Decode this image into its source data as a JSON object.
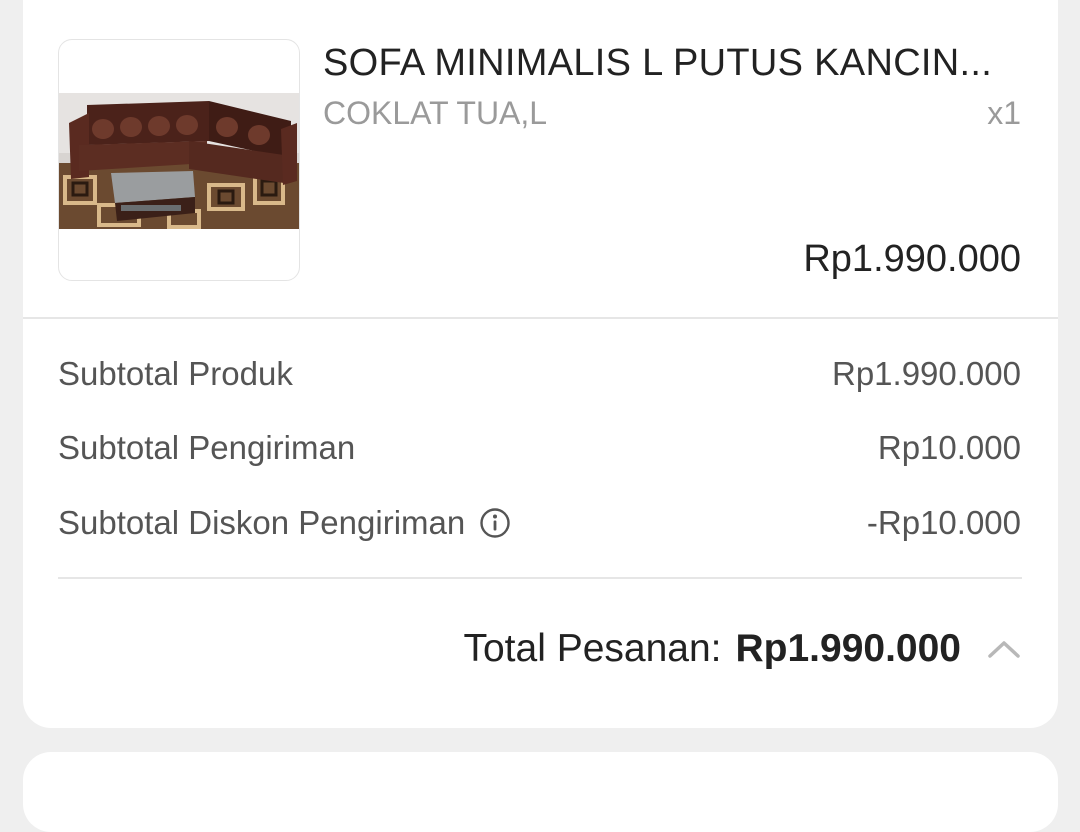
{
  "order_item": {
    "name": "SOFA MINIMALIS L PUTUS KANCIN...",
    "variant": "COKLAT TUA,L",
    "quantity": "x1",
    "price": "Rp1.990.000",
    "thumbnail_icon": "sofa-product-image"
  },
  "summary": {
    "rows": [
      {
        "label": "Subtotal Produk",
        "value": "Rp1.990.000"
      },
      {
        "label": "Subtotal Pengiriman",
        "value": "Rp10.000"
      },
      {
        "label": "Subtotal Diskon Pengiriman",
        "value": "-Rp10.000",
        "icon": "info-icon"
      }
    ],
    "total_label": "Total Pesanan:",
    "total_value": "Rp1.990.000",
    "toggle_icon": "chevron-up-icon"
  },
  "colors": {
    "background": "#efefef",
    "card": "#ffffff",
    "text_primary": "#222222",
    "text_secondary": "#555555",
    "text_muted": "#9a9a9a",
    "divider": "#e6e6e6"
  }
}
